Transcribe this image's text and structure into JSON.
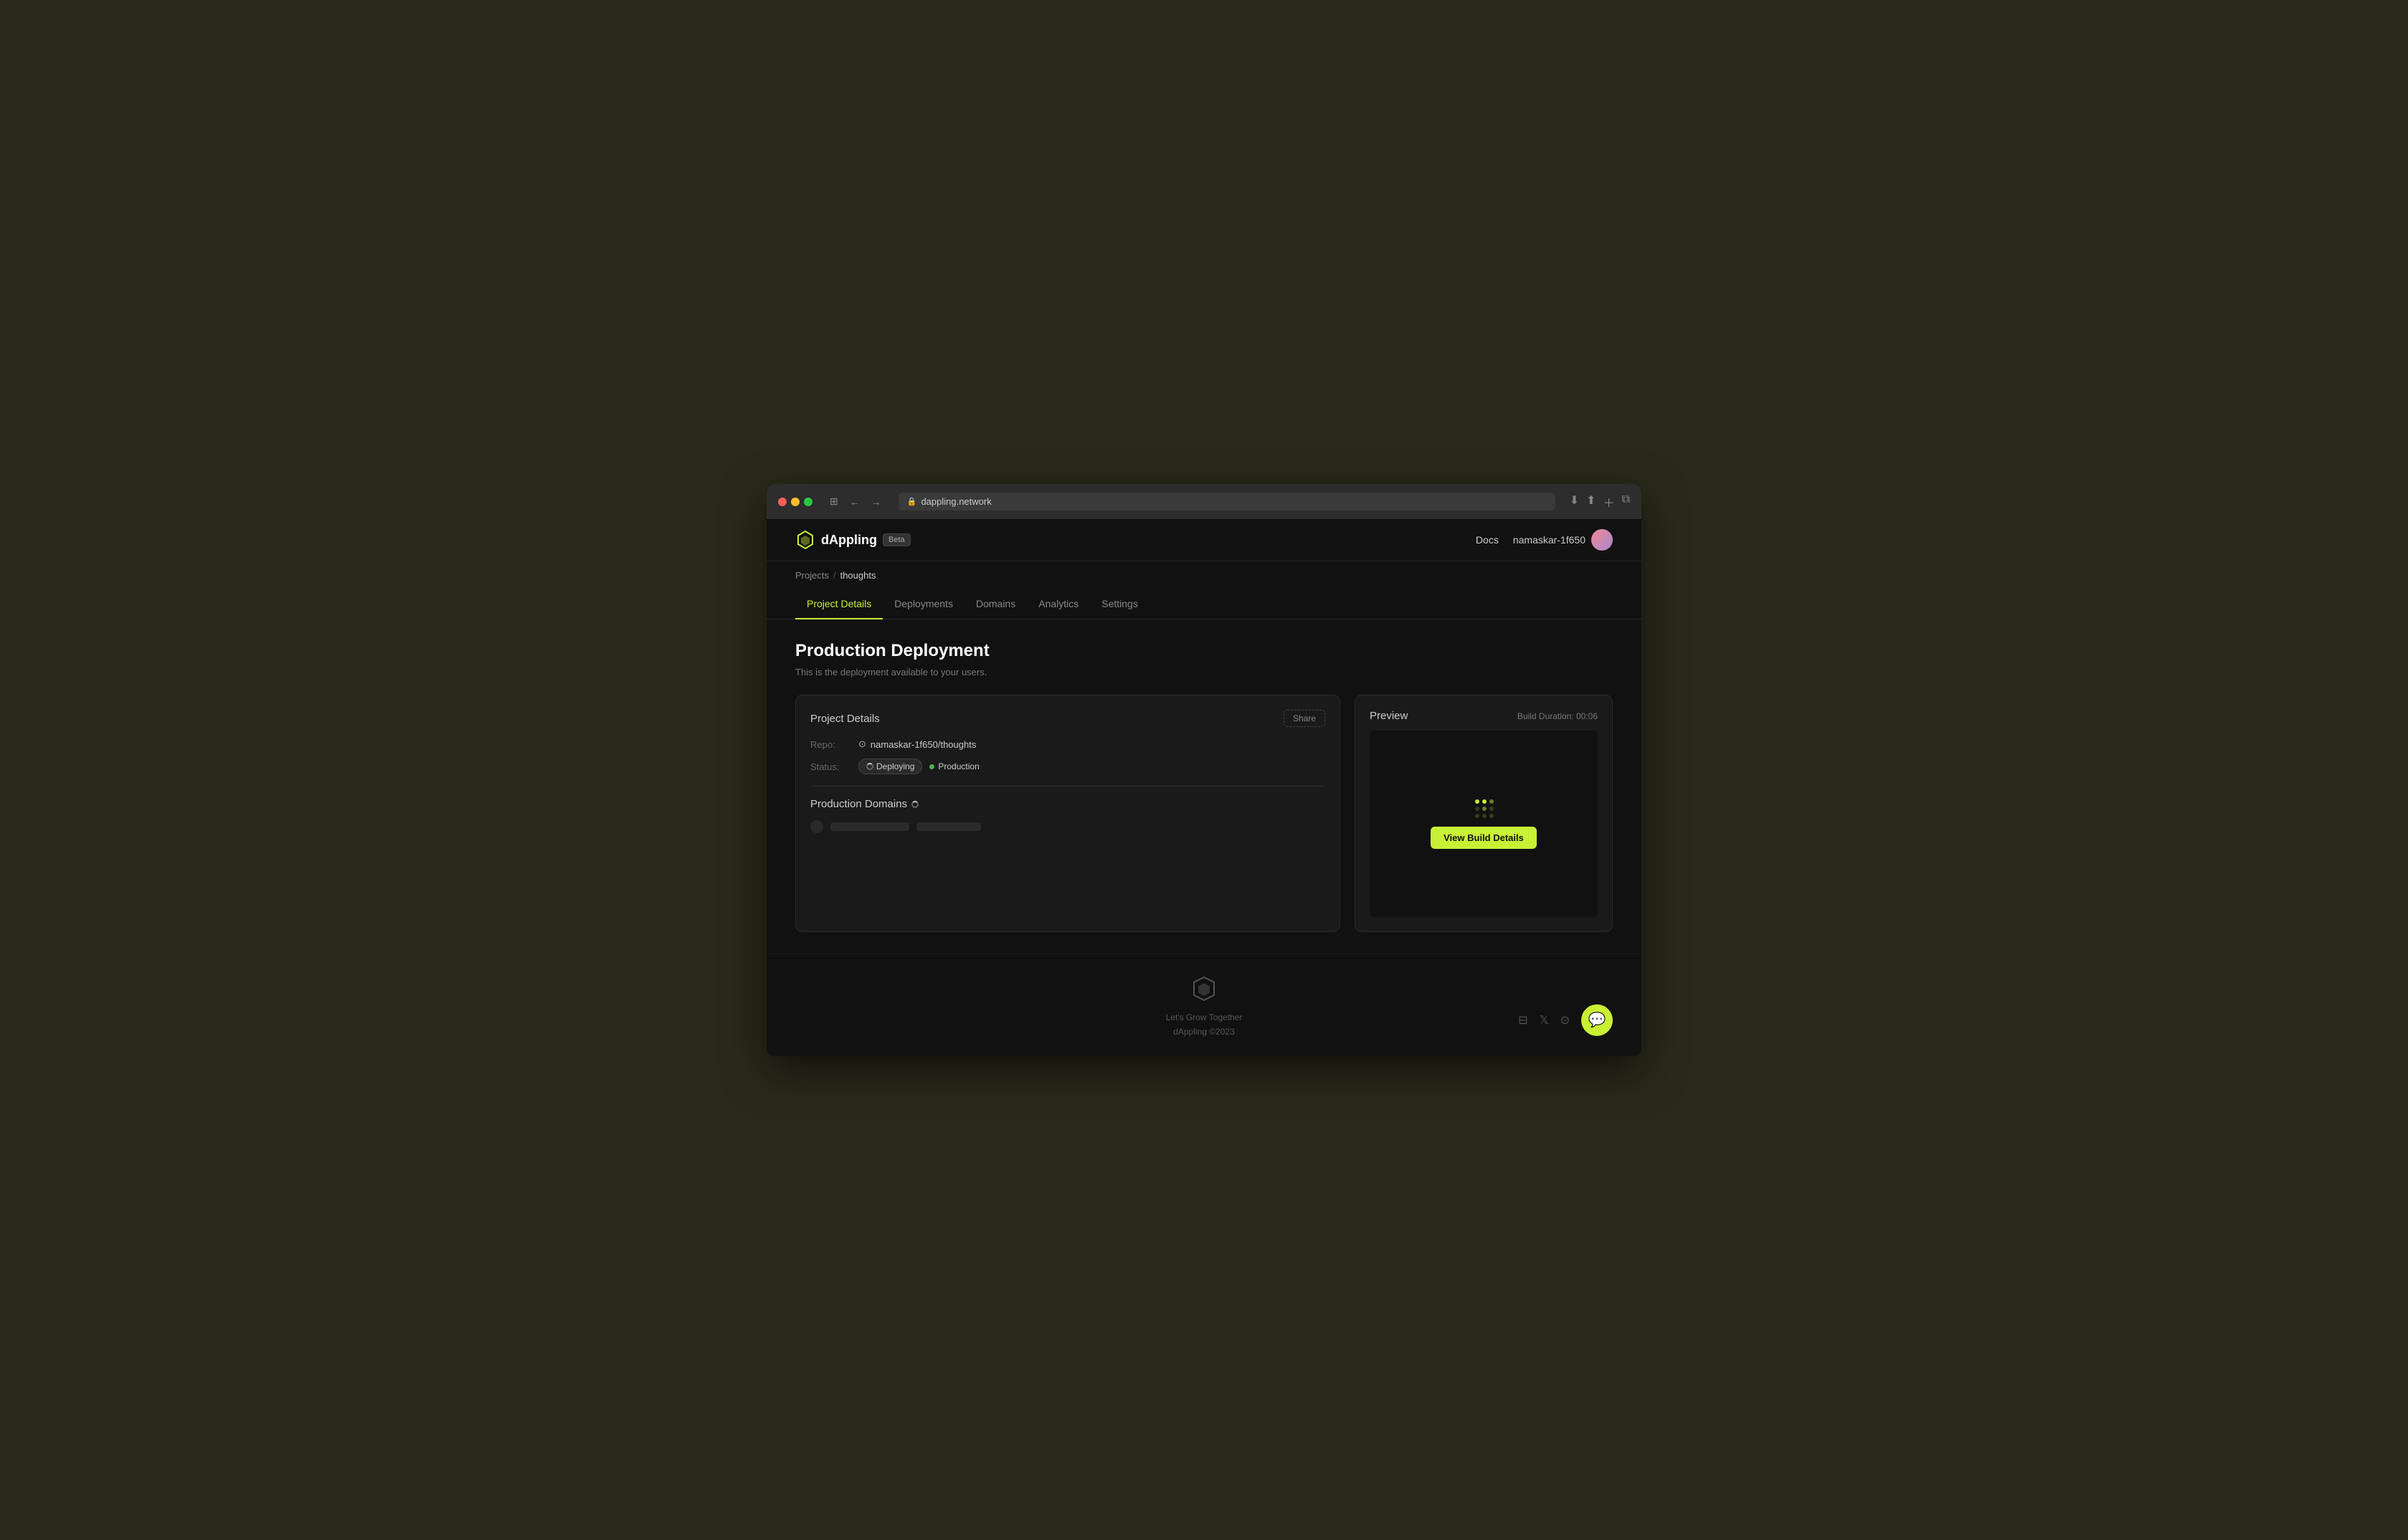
{
  "browser": {
    "url": "dappling.network",
    "back_btn": "←",
    "forward_btn": "→"
  },
  "header": {
    "logo_text": "dAppling",
    "beta_label": "Beta",
    "docs_label": "Docs",
    "username": "namaskar-1f650"
  },
  "breadcrumb": {
    "projects_label": "Projects",
    "separator": "/",
    "current": "thoughts"
  },
  "nav": {
    "tabs": [
      {
        "id": "project-details",
        "label": "Project Details",
        "active": true
      },
      {
        "id": "deployments",
        "label": "Deployments",
        "active": false
      },
      {
        "id": "domains",
        "label": "Domains",
        "active": false
      },
      {
        "id": "analytics",
        "label": "Analytics",
        "active": false
      },
      {
        "id": "settings",
        "label": "Settings",
        "active": false
      }
    ]
  },
  "page": {
    "title": "Production Deployment",
    "subtitle": "This is the deployment available to your users."
  },
  "project_details_card": {
    "title": "Project Details",
    "share_label": "Share",
    "repo_label": "Repo:",
    "repo_value": "namaskar-1f650/thoughts",
    "status_label": "Status:",
    "status_deploying": "Deploying",
    "status_production": "Production",
    "production_domains_title": "Production Domains"
  },
  "preview_card": {
    "title": "Preview",
    "build_duration_label": "Build Duration:",
    "build_duration_value": "00:06",
    "view_build_label": "View Build Details"
  },
  "footer": {
    "tagline": "Let's Grow Together",
    "copyright": "dAppling ©2023"
  }
}
